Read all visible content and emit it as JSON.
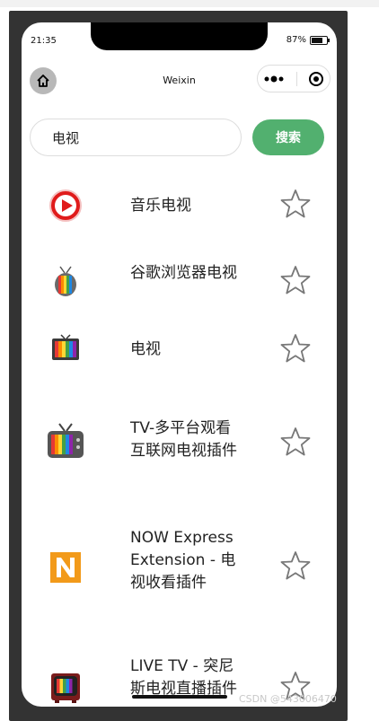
{
  "status_bar": {
    "time": "21:35",
    "battery": "87%"
  },
  "navbar": {
    "title": "Weixin"
  },
  "search": {
    "value": "电视",
    "button_label": "搜索"
  },
  "results": [
    {
      "name": "音乐电视",
      "icon": "play-icon"
    },
    {
      "name": "谷歌浏览器电视",
      "icon": "antenna-tv-icon"
    },
    {
      "name": "电视",
      "icon": "tv-icon"
    },
    {
      "name": "TV-多平台观看互联网电视插件",
      "icon": "retro-tv-icon"
    },
    {
      "name": "NOW Express Extension - 电视收看插件",
      "icon": "n-logo-icon"
    },
    {
      "name": "LIVE TV - 突尼斯电视直播插件",
      "icon": "vintage-tv-icon"
    }
  ],
  "watermark": "CSDN @543006470",
  "colors": {
    "accent": "#52b06f",
    "frame": "#333333"
  }
}
